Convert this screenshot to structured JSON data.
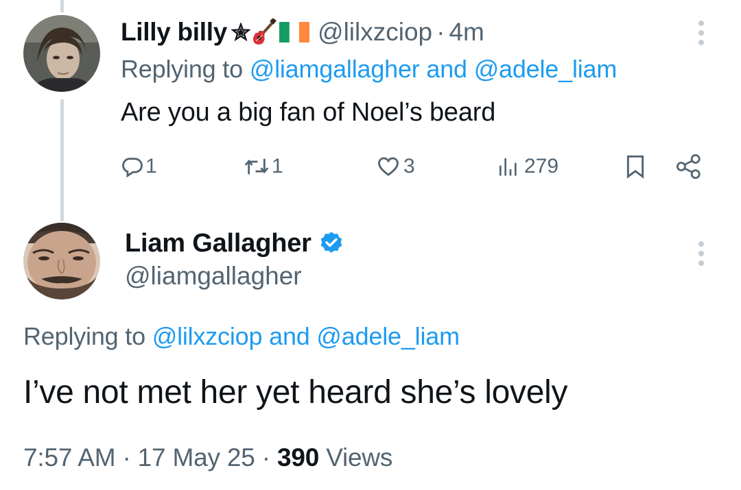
{
  "parent_tweet": {
    "display_name": "Lilly billy",
    "name_emojis": [
      "star-icon",
      "guitar-icon",
      "ireland-flag-icon"
    ],
    "handle": "@lilxzciop",
    "separator": "·",
    "time": "4m",
    "replying_prefix": "Replying to",
    "replying_user_1": "@liamgallagher",
    "replying_and": "and",
    "replying_user_2": "@adele_liam",
    "text": "Are you a big fan of Noel’s beard",
    "reply_count": "1",
    "repost_count": "1",
    "like_count": "3",
    "view_count": "279"
  },
  "main_tweet": {
    "display_name": "Liam Gallagher",
    "verified": true,
    "handle": "@liamgallagher",
    "replying_prefix": "Replying to",
    "replying_user_1": "@lilxzciop",
    "replying_and": "and",
    "replying_user_2": "@adele_liam",
    "text": "I’ve not met her yet heard she’s lovely",
    "time": "7:57 AM",
    "separator": "·",
    "date": "17 May 25",
    "views_count": "390",
    "views_label": "Views"
  },
  "colors": {
    "link": "#1d9bf0",
    "secondary_text": "#536471",
    "primary_text": "#0f1419",
    "thread_line": "#cfd9de"
  }
}
